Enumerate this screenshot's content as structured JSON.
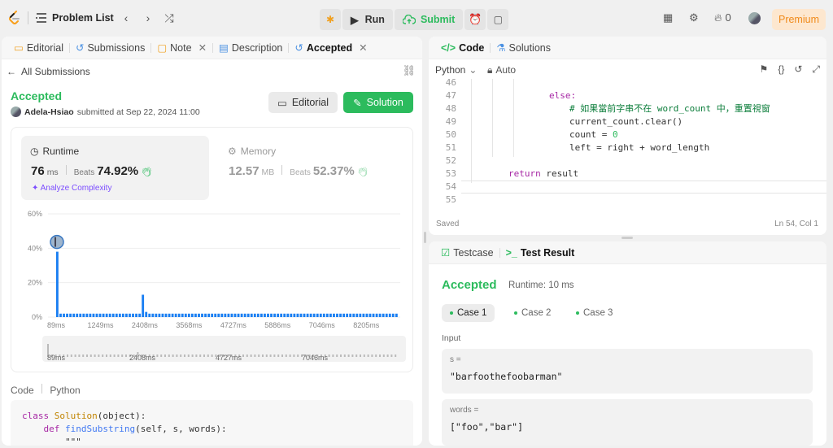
{
  "topbar": {
    "problem_list": "Problem List",
    "run_label": "Run",
    "submit_label": "Submit",
    "streak_count": "0",
    "premium_label": "Premium"
  },
  "left_tabs": [
    {
      "label": "Editorial"
    },
    {
      "label": "Submissions"
    },
    {
      "label": "Note"
    },
    {
      "label": "Description"
    },
    {
      "label": "Accepted"
    }
  ],
  "submission": {
    "back_label": "All Submissions",
    "status": "Accepted",
    "user": "Adela-Hsiao",
    "submitted_text": "submitted at Sep 22, 2024 11:00",
    "editorial_btn": "Editorial",
    "solution_btn": "Solution",
    "runtime_label": "Runtime",
    "runtime_value": "76",
    "runtime_unit": "ms",
    "runtime_beats_label": "Beats",
    "runtime_beats": "74.92%",
    "analyze_label": "Analyze Complexity",
    "memory_label": "Memory",
    "memory_value": "12.57",
    "memory_unit": "MB",
    "memory_beats_label": "Beats",
    "memory_beats": "52.37%"
  },
  "chart_data": {
    "type": "bar",
    "y_ticks": [
      "60%",
      "40%",
      "20%",
      "0%"
    ],
    "ylim": [
      0,
      60
    ],
    "x_ticks": [
      "89ms",
      "1249ms",
      "2408ms",
      "3568ms",
      "4727ms",
      "5886ms",
      "7046ms",
      "8205ms"
    ],
    "slider_ticks": [
      "89ms",
      "2408ms",
      "4727ms",
      "7046ms"
    ],
    "values": [
      38,
      2,
      2,
      2,
      2,
      2,
      2,
      2,
      2,
      2,
      2,
      2,
      2,
      2,
      2,
      2,
      2,
      2,
      2,
      2,
      2,
      2,
      2,
      2,
      2,
      2,
      13,
      3,
      2,
      2,
      2,
      2,
      2,
      2,
      2,
      2,
      2,
      2,
      2,
      2,
      2,
      2,
      2,
      2,
      2,
      2,
      2,
      2,
      2,
      2,
      2,
      2,
      2,
      2,
      2,
      2,
      2,
      2,
      2,
      2,
      2,
      2,
      2,
      2,
      2,
      2,
      2,
      2,
      2,
      2,
      2,
      2,
      2,
      2,
      2,
      2,
      2,
      2,
      2,
      2,
      2,
      2,
      2,
      2,
      2,
      2,
      2,
      2,
      2,
      2,
      2,
      2,
      2,
      2,
      2,
      2,
      2,
      2,
      2,
      2,
      2,
      2,
      2,
      2
    ],
    "highlight_index": 0
  },
  "code_preview": {
    "header_code": "Code",
    "header_lang": "Python",
    "lines": [
      {
        "parts": [
          [
            "kw",
            "class "
          ],
          [
            "cls",
            "Solution"
          ],
          [
            "",
            "(object):"
          ]
        ]
      },
      {
        "parts": [
          [
            "",
            "    "
          ],
          [
            "kw",
            "def "
          ],
          [
            "fn",
            "findSubstring"
          ],
          [
            "",
            "(self, s, words):"
          ]
        ]
      },
      {
        "parts": [
          [
            "",
            "        \"\"\""
          ]
        ]
      }
    ]
  },
  "right_tabs": {
    "code": "Code",
    "solutions": "Solutions"
  },
  "editor": {
    "language": "Python",
    "auto_label": "Auto",
    "saved_label": "Saved",
    "cursor_pos": "Ln 54, Col 1",
    "lines": [
      {
        "n": "46",
        "parts": [
          [
            "",
            ""
          ]
        ],
        "indent": 0
      },
      {
        "n": "47",
        "parts": [
          [
            "kw",
            "else:"
          ]
        ],
        "indent": 4
      },
      {
        "n": "48",
        "parts": [
          [
            "cm",
            "# 如果當前字串不在 word_count 中，重置視窗"
          ]
        ],
        "indent": 5
      },
      {
        "n": "49",
        "parts": [
          [
            "",
            "current_count.clear()"
          ]
        ],
        "indent": 5
      },
      {
        "n": "50",
        "parts": [
          [
            "",
            "count = "
          ],
          [
            "num",
            "0"
          ]
        ],
        "indent": 5
      },
      {
        "n": "51",
        "parts": [
          [
            "",
            "left = right + word_length"
          ]
        ],
        "indent": 5
      },
      {
        "n": "52",
        "parts": [
          [
            "",
            ""
          ]
        ],
        "indent": 0
      },
      {
        "n": "53",
        "parts": [
          [
            "kw",
            "return "
          ],
          [
            "",
            "result"
          ]
        ],
        "indent": 2
      },
      {
        "n": "54",
        "parts": [
          [
            "",
            ""
          ]
        ],
        "indent": 0
      },
      {
        "n": "55",
        "parts": [
          [
            "",
            ""
          ]
        ],
        "indent": 0
      }
    ]
  },
  "test_tabs": {
    "testcase": "Testcase",
    "result": "Test Result"
  },
  "test_result": {
    "status": "Accepted",
    "runtime": "Runtime: 10 ms",
    "cases": [
      "Case 1",
      "Case 2",
      "Case 3"
    ],
    "input_label": "Input",
    "inputs": [
      {
        "name": "s =",
        "value": "\"barfoothefoobarman\""
      },
      {
        "name": "words =",
        "value": "[\"foo\",\"bar\"]"
      }
    ]
  },
  "colors": {
    "accent": "#2cbb5d",
    "premium": "#f08a1a",
    "bar": "#1a7ff2",
    "purple": "#7c4dff"
  }
}
